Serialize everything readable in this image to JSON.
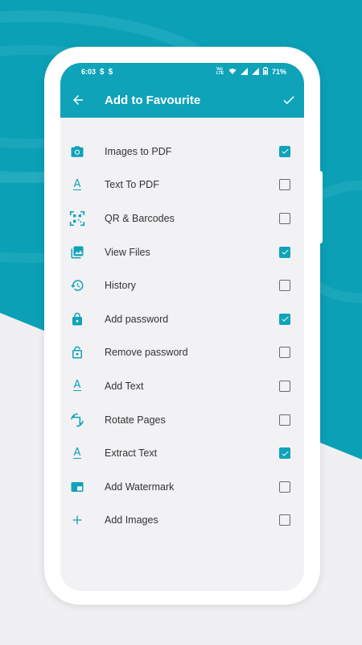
{
  "colors": {
    "accent": "#0fa3b9",
    "background_teal": "#0ba0b6",
    "background_light": "#f0eff1"
  },
  "status_bar": {
    "time": "6:03",
    "left_icons": [
      "s-notification-icon",
      "s-notification-icon"
    ],
    "network_label": "Vo) LTE",
    "battery": "71%"
  },
  "toolbar": {
    "title": "Add to Favourite",
    "back_icon": "arrow-back-icon",
    "confirm_icon": "check-icon"
  },
  "items": [
    {
      "label": "Images to PDF",
      "icon": "camera-icon",
      "checked": true
    },
    {
      "label": "Text To PDF",
      "icon": "text-a-icon",
      "checked": false
    },
    {
      "label": "QR & Barcodes",
      "icon": "qr-code-icon",
      "checked": false
    },
    {
      "label": "View Files",
      "icon": "image-gallery-icon",
      "checked": true
    },
    {
      "label": "History",
      "icon": "history-icon",
      "checked": false
    },
    {
      "label": "Add password",
      "icon": "lock-icon",
      "checked": true
    },
    {
      "label": "Remove password",
      "icon": "unlock-icon",
      "checked": false
    },
    {
      "label": "Add Text",
      "icon": "text-a-icon",
      "checked": false
    },
    {
      "label": "Rotate Pages",
      "icon": "rotate-icon",
      "checked": false
    },
    {
      "label": "Extract Text",
      "icon": "text-a-icon",
      "checked": true
    },
    {
      "label": "Add Watermark",
      "icon": "watermark-icon",
      "checked": false
    },
    {
      "label": "Add Images",
      "icon": "plus-icon",
      "checked": false
    }
  ]
}
